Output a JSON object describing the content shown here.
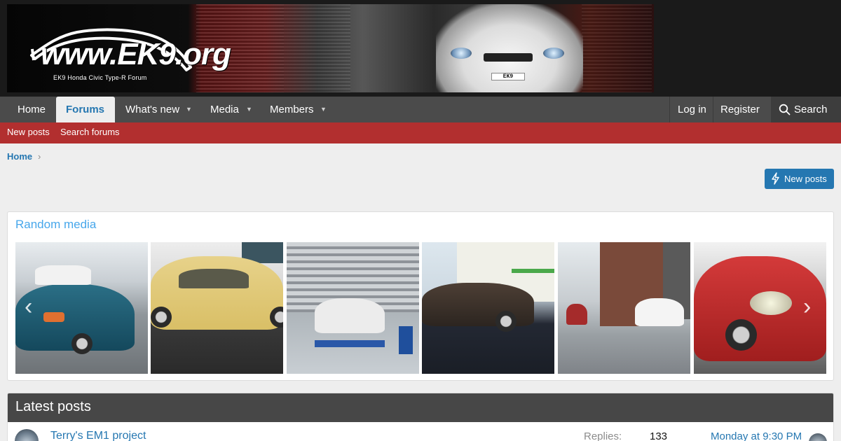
{
  "site": {
    "logo_main": "www.EK9.org",
    "logo_tagline": "EK9 Honda Civic Type-R Forum",
    "banner_plate": "EK9"
  },
  "nav": {
    "items": [
      {
        "label": "Home"
      },
      {
        "label": "Forums",
        "active": true
      },
      {
        "label": "What's new"
      },
      {
        "label": "Media"
      },
      {
        "label": "Members"
      }
    ],
    "login": "Log in",
    "register": "Register",
    "search": "Search"
  },
  "subnav": {
    "items": [
      {
        "label": "New posts"
      },
      {
        "label": "Search forums"
      }
    ]
  },
  "breadcrumb": {
    "home": "Home"
  },
  "actions": {
    "new_posts": "New posts"
  },
  "random_media": {
    "title": "Random media"
  },
  "latest_posts": {
    "title": "Latest posts",
    "rows": [
      {
        "title": "Terry's EM1 project",
        "replies_label": "Replies:",
        "replies": "133",
        "last_post": "Monday at 9:30 PM"
      }
    ]
  },
  "colors": {
    "accent": "#2577b1",
    "nav_bg": "#4b4b4b",
    "subnav_bg": "#b22f2f",
    "media_title": "#47a7eb"
  }
}
